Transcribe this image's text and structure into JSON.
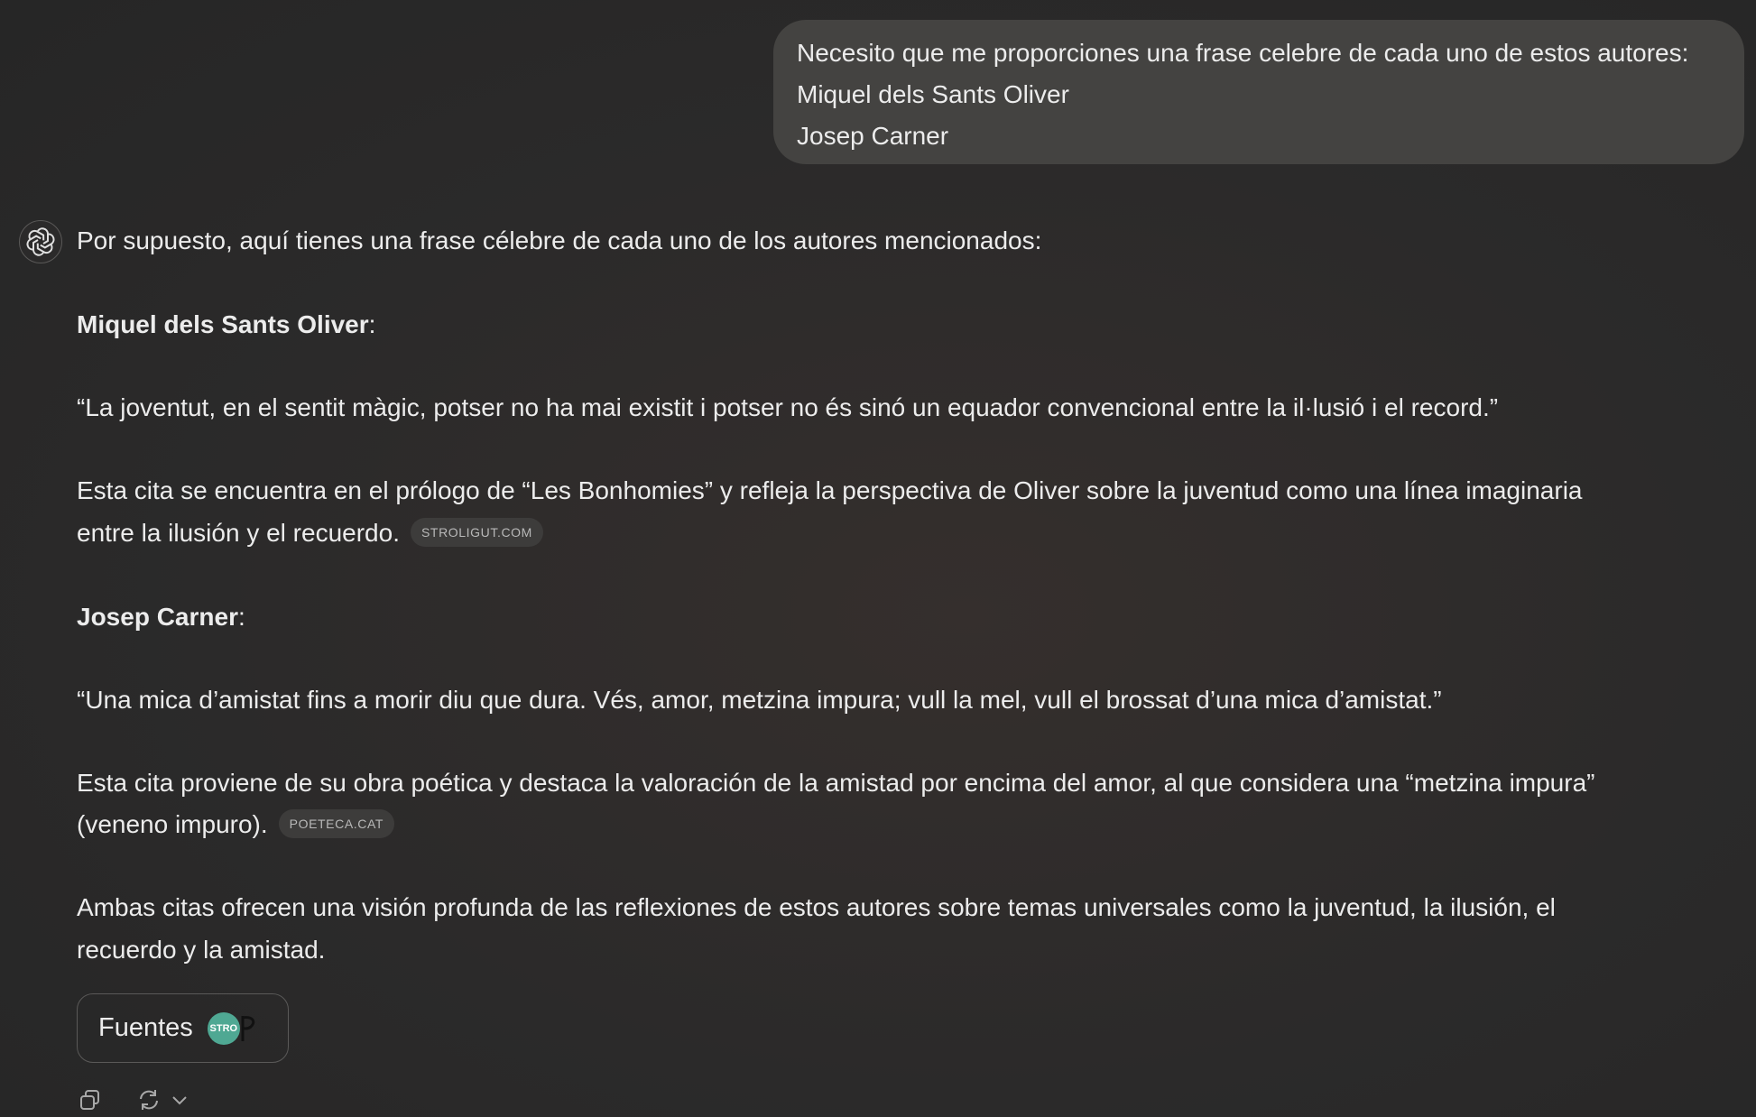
{
  "user_message": {
    "lines": [
      "Necesito que me proporciones una frase celebre de cada uno de estos autores:",
      "Miquel dels Sants Oliver",
      "Josep Carner"
    ]
  },
  "assistant": {
    "intro": "Por supuesto, aquí tienes una frase célebre de cada uno de los autores mencionados:",
    "author1": {
      "name": "Miquel dels Sants Oliver",
      "suffix": ":"
    },
    "quote1": "“La joventut, en el sentit màgic, potser no ha mai existit i potser no és sinó un equador convencional entre la il·lusió i el record.”",
    "explain1": [
      "Esta cita se encuentra en el prólogo de “Les Bonhomies” y refleja la perspectiva de Oliver sobre la juventud como una línea imaginaria",
      "entre la ilusión y el recuerdo."
    ],
    "cite1": "STROLIGUT.COM",
    "author2": {
      "name": "Josep Carner",
      "suffix": ":"
    },
    "quote2": "“Una mica d’amistat fins a morir diu que dura. Vés, amor, metzina impura; vull la mel, vull el brossat d’una mica d’amistat.”",
    "explain2": [
      "Esta cita proviene de su obra poética y destaca la valoración de la amistad por encima del amor, al que considera una “metzina impura”",
      "(veneno impuro)."
    ],
    "cite2": "POETECA.CAT",
    "closing": [
      "Ambas citas ofrecen una visión profunda de las reflexiones de estos autores sobre temas universales como la juventud, la ilusión, el",
      "recuerdo y la amistad."
    ],
    "sources_label": "Fuentes",
    "source_favicon_label": "STRO"
  },
  "icons": {
    "avatar": "openai-logo-icon",
    "copy": "copy-icon",
    "regenerate": "regenerate-icon",
    "dropdown": "chevron-down-icon"
  },
  "colors": {
    "background": "#2b2a2a",
    "user_bubble": "#444341",
    "text": "#ececec",
    "citation_pill": "#3d3c3b",
    "favicon_green": "#4fa893"
  }
}
